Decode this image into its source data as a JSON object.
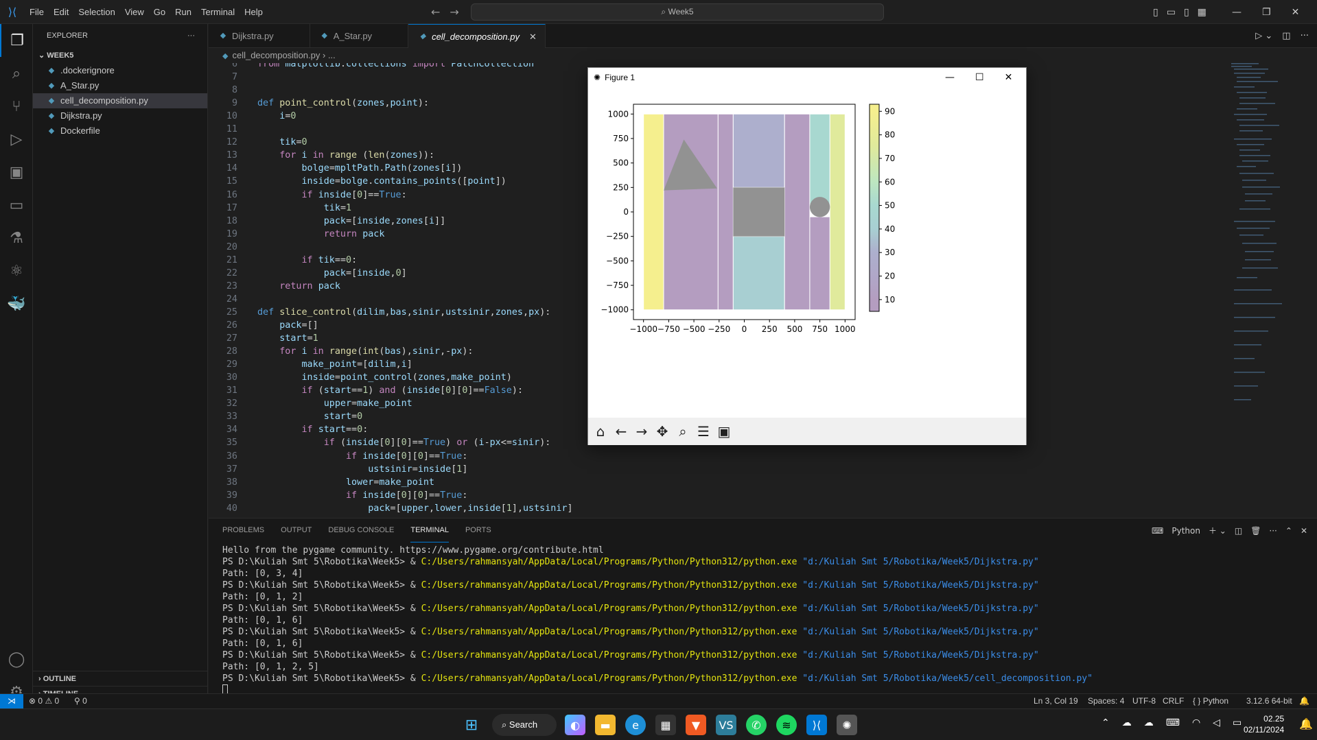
{
  "titlebar": {
    "menu": [
      "File",
      "Edit",
      "Selection",
      "View",
      "Go",
      "Run",
      "Terminal",
      "Help"
    ],
    "search_text": "Week5"
  },
  "sidebar": {
    "header": "EXPLORER",
    "folder": "WEEK5",
    "files": [
      {
        "name": ".dockerignore",
        "icon": "docker-file-icon"
      },
      {
        "name": "A_Star.py",
        "icon": "python-file-icon"
      },
      {
        "name": "cell_decomposition.py",
        "icon": "python-file-icon"
      },
      {
        "name": "Dijkstra.py",
        "icon": "python-file-icon"
      },
      {
        "name": "Dockerfile",
        "icon": "docker-file-icon"
      }
    ],
    "outline": "OUTLINE",
    "timeline": "TIMELINE"
  },
  "tabs": [
    {
      "label": "Dijkstra.py"
    },
    {
      "label": "A_Star.py"
    },
    {
      "label": "cell_decomposition.py"
    }
  ],
  "breadcrumb": {
    "file": "cell_decomposition.py",
    "rest": "..."
  },
  "code": {
    "line_numbers": [
      "6",
      "7",
      "8",
      "9",
      "10",
      "11",
      "12",
      "13",
      "14",
      "15",
      "16",
      "17",
      "18",
      "19",
      "20",
      "21",
      "22",
      "23",
      "24",
      "25",
      "26",
      "27",
      "28",
      "29",
      "30",
      "31",
      "32",
      "33",
      "34",
      "35",
      "36",
      "37",
      "38",
      "39",
      "40"
    ],
    "lines": [
      "from matplotlib.collections import PatchCollection",
      "",
      "",
      "def point_control(zones,point):",
      "    i=0",
      "",
      "    tik=0",
      "    for i in range (len(zones)):",
      "        bolge=mpltPath.Path(zones[i])",
      "        inside=bolge.contains_points([point])",
      "        if inside[0]==True:",
      "            tik=1",
      "            pack=[inside,zones[i]]",
      "            return pack",
      "",
      "        if tik==0:",
      "            pack=[inside,0]",
      "    return pack",
      "",
      "def slice_control(dilim,bas,sinir,ustsinir,zones,px):",
      "    pack=[]",
      "    start=1",
      "    for i in range(int(bas),sinir,-px):",
      "        make_point=[dilim,i]",
      "        inside=point_control(zones,make_point)",
      "        if (start==1) and (inside[0][0]==False):",
      "            upper=make_point",
      "            start=0",
      "        if start==0:",
      "            if (inside[0][0]==True) or (i-px<=sinir):",
      "                if inside[0][0]==True:",
      "                    ustsinir=inside[1]",
      "                lower=make_point",
      "                if inside[0][0]==True:",
      "                    pack=[upper,lower,inside[1],ustsinir]"
    ]
  },
  "panel": {
    "tabs": [
      "PROBLEMS",
      "OUTPUT",
      "DEBUG CONSOLE",
      "TERMINAL",
      "PORTS"
    ],
    "active_tab": "TERMINAL",
    "shell": "Python",
    "terminal": [
      {
        "prompt": "Hello from the pygame community. https://www.pygame.org/contribute.html",
        "cmd": "",
        "arg": ""
      },
      {
        "prompt": "PS D:\\Kuliah Smt 5\\Robotika\\Week5> & ",
        "cmd": "C:/Users/rahmansyah/AppData/Local/Programs/Python/Python312/python.exe",
        "arg": " \"d:/Kuliah Smt 5/Robotika/Week5/Dijkstra.py\""
      },
      {
        "prompt": "Path: [0, 3, 4]",
        "cmd": "",
        "arg": ""
      },
      {
        "prompt": "PS D:\\Kuliah Smt 5\\Robotika\\Week5> & ",
        "cmd": "C:/Users/rahmansyah/AppData/Local/Programs/Python/Python312/python.exe",
        "arg": " \"d:/Kuliah Smt 5/Robotika/Week5/Dijkstra.py\""
      },
      {
        "prompt": "Path: [0, 1, 2]",
        "cmd": "",
        "arg": ""
      },
      {
        "prompt": "PS D:\\Kuliah Smt 5\\Robotika\\Week5> & ",
        "cmd": "C:/Users/rahmansyah/AppData/Local/Programs/Python/Python312/python.exe",
        "arg": " \"d:/Kuliah Smt 5/Robotika/Week5/Dijkstra.py\""
      },
      {
        "prompt": "Path: [0, 1, 6]",
        "cmd": "",
        "arg": ""
      },
      {
        "prompt": "PS D:\\Kuliah Smt 5\\Robotika\\Week5> & ",
        "cmd": "C:/Users/rahmansyah/AppData/Local/Programs/Python/Python312/python.exe",
        "arg": " \"d:/Kuliah Smt 5/Robotika/Week5/Dijkstra.py\""
      },
      {
        "prompt": "Path: [0, 1, 6]",
        "cmd": "",
        "arg": ""
      },
      {
        "prompt": "PS D:\\Kuliah Smt 5\\Robotika\\Week5> & ",
        "cmd": "C:/Users/rahmansyah/AppData/Local/Programs/Python/Python312/python.exe",
        "arg": " \"d:/Kuliah Smt 5/Robotika/Week5/Dijkstra.py\""
      },
      {
        "prompt": "Path: [0, 1, 2, 5]",
        "cmd": "",
        "arg": ""
      },
      {
        "prompt": "PS D:\\Kuliah Smt 5\\Robotika\\Week5> & ",
        "cmd": "C:/Users/rahmansyah/AppData/Local/Programs/Python/Python312/python.exe",
        "arg": " \"d:/Kuliah Smt 5/Robotika/Week5/cell_decomposition.py\""
      }
    ]
  },
  "statusbar": {
    "errors": "0",
    "warnings": "0",
    "ports": "0",
    "position": "Ln 3, Col 19",
    "spaces": "Spaces: 4",
    "encoding": "UTF-8",
    "eol": "CRLF",
    "language": "Python",
    "interpreter": "3.12.6 64-bit"
  },
  "taskbar": {
    "search": "Search",
    "time": "02.25",
    "date": "02/11/2024"
  },
  "figure": {
    "title": "Figure 1",
    "colors": {
      "yellow": "#f5ef8e",
      "purple": "#b49dc0",
      "lavender": "#adafcd",
      "teal": "#a8d8d0",
      "green": "#bde6c0",
      "lime": "#e0ea9c",
      "obstacle": "#929292"
    }
  },
  "chart_data": {
    "type": "heatmap",
    "title": "",
    "xlabel": "",
    "ylabel": "",
    "xlim": [
      -1100,
      1100
    ],
    "ylim": [
      -1100,
      1100
    ],
    "x_ticks": [
      "−1000",
      "−750",
      "−500",
      "−250",
      "0",
      "250",
      "500",
      "750",
      "1000"
    ],
    "y_ticks": [
      "1000",
      "750",
      "500",
      "250",
      "0",
      "−250",
      "−500",
      "−750",
      "−1000"
    ],
    "colorbar_ticks": [
      "90",
      "80",
      "70",
      "60",
      "50",
      "40",
      "30",
      "20",
      "10"
    ],
    "cells": [
      {
        "x0": -1000,
        "x1": -800,
        "y0": -1000,
        "y1": 1000,
        "value": 90
      },
      {
        "x0": -800,
        "x1": -260,
        "y0": -1000,
        "y1": 1000,
        "value": 15
      },
      {
        "x0": -260,
        "x1": -110,
        "y0": -1000,
        "y1": 1000,
        "value": 12
      },
      {
        "x0": -110,
        "x1": 400,
        "y0": 250,
        "y1": 1000,
        "value": 30
      },
      {
        "x0": -110,
        "x1": 400,
        "y0": -1000,
        "y1": -250,
        "value": 45
      },
      {
        "x0": 400,
        "x1": 650,
        "y0": -1000,
        "y1": 1000,
        "value": 15
      },
      {
        "x0": 650,
        "x1": 850,
        "y0": 60,
        "y1": 1000,
        "value": 58
      },
      {
        "x0": 650,
        "x1": 850,
        "y0": -1000,
        "y1": -50,
        "value": 17
      },
      {
        "x0": 850,
        "x1": 1000,
        "y0": -1000,
        "y1": 1000,
        "value": 75
      }
    ],
    "obstacles": [
      {
        "shape": "triangle",
        "points": [
          [
            -800,
            220
          ],
          [
            -600,
            740
          ],
          [
            -270,
            240
          ]
        ]
      },
      {
        "shape": "rectangle",
        "x0": -110,
        "x1": 400,
        "y0": -250,
        "y1": 250
      },
      {
        "shape": "circle",
        "cx": 750,
        "cy": 50,
        "r": 100
      }
    ]
  }
}
